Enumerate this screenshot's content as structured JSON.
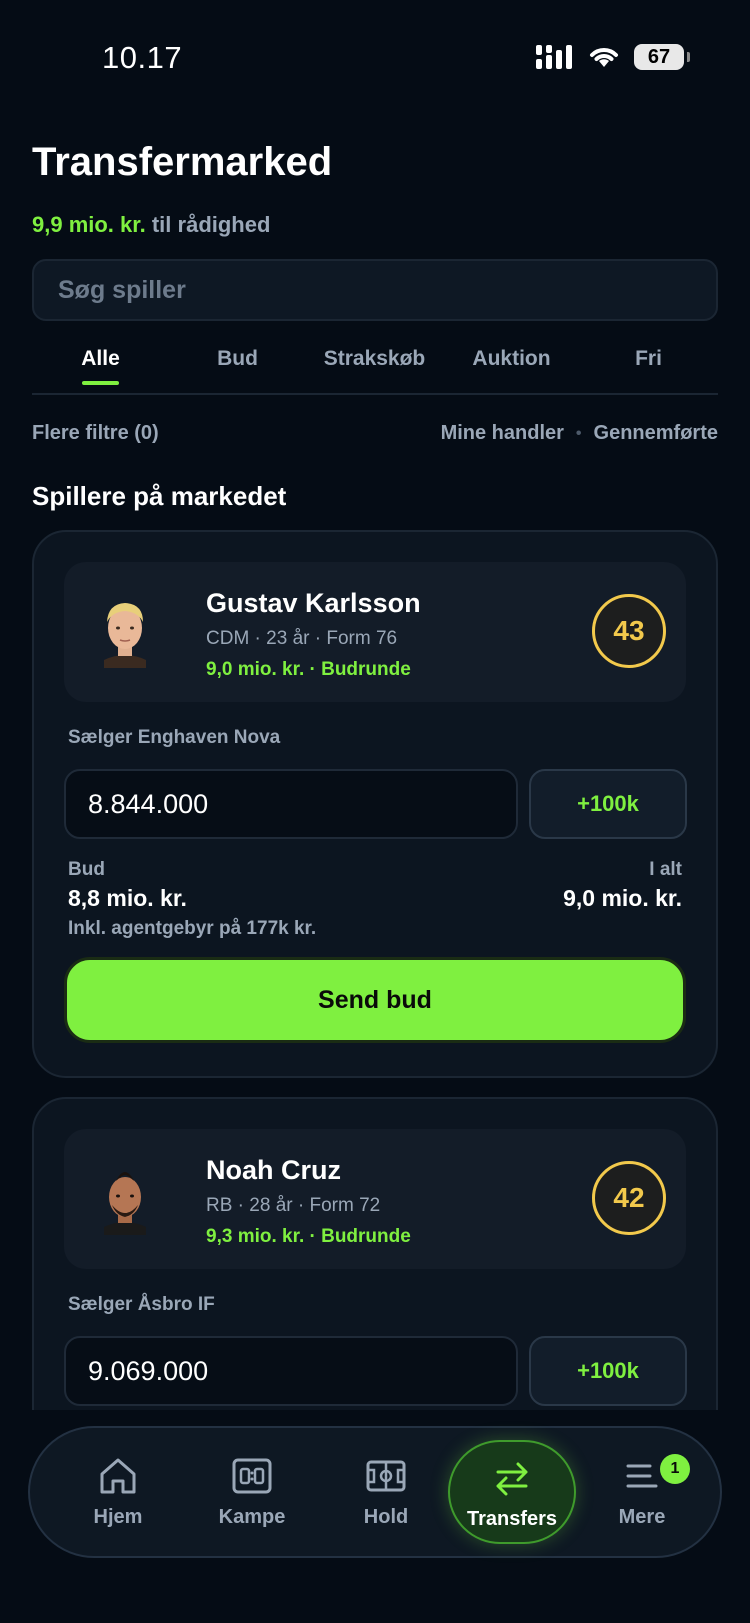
{
  "status_bar": {
    "time": "10.17",
    "battery": "67"
  },
  "header": {
    "title": "Transfermarked",
    "budget_amount": "9,9 mio. kr.",
    "budget_suffix": "til rådighed"
  },
  "search": {
    "placeholder": "Søg spiller"
  },
  "tabs": [
    {
      "label": "Alle",
      "active": true
    },
    {
      "label": "Bud"
    },
    {
      "label": "Strakskøb"
    },
    {
      "label": "Auktion"
    },
    {
      "label": "Fri"
    }
  ],
  "filters": {
    "more_filters": "Flere filtre (0)",
    "my_trades": "Mine handler",
    "completed": "Gennemførte"
  },
  "section_title": "Spillere på markedet",
  "players": [
    {
      "name": "Gustav Karlsson",
      "meta": "CDM · 23 år · Form 76",
      "price": "9,0 mio. kr. · Budrunde",
      "rating": "43",
      "seller": "Sælger Enghaven Nova",
      "bid_value": "8.844.000",
      "increment": "+100k",
      "bid_label": "Bud",
      "bid_amount": "8,8 mio. kr.",
      "total_label": "I alt",
      "total_amount": "9,0 mio. kr.",
      "fee_note": "Inkl. agentgebyr på 177k kr.",
      "send_label": "Send bud"
    },
    {
      "name": "Noah Cruz",
      "meta": "RB · 28 år · Form 72",
      "price": "9,3 mio. kr. · Budrunde",
      "rating": "42",
      "seller": "Sælger Åsbro IF",
      "bid_value": "9.069.000",
      "increment": "+100k"
    }
  ],
  "nav": [
    {
      "label": "Hjem",
      "icon": "home-icon"
    },
    {
      "label": "Kampe",
      "icon": "scoreboard-icon"
    },
    {
      "label": "Hold",
      "icon": "pitch-icon"
    },
    {
      "label": "Transfers",
      "icon": "transfer-arrows-icon",
      "active": true
    },
    {
      "label": "Mere",
      "icon": "menu-icon",
      "badge": "1"
    }
  ],
  "colors": {
    "accent": "#7ff040",
    "background": "#050c15",
    "rating": "#f2c94c"
  }
}
